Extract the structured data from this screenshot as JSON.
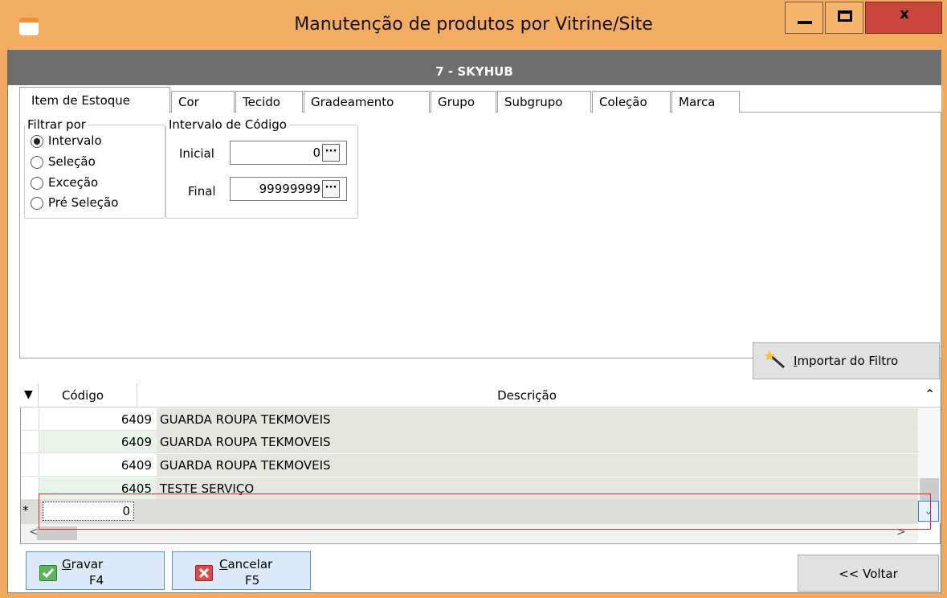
{
  "window": {
    "title": "Manutenção de produtos por Vitrine/Site",
    "minimize_icon": "minimize-icon",
    "maximize_icon": "maximize-icon",
    "close_label": "x"
  },
  "header": {
    "title": "7 - SKYHUB"
  },
  "tabs": [
    {
      "label": "Item de Estoque",
      "active": true
    },
    {
      "label": "Cor"
    },
    {
      "label": "Tecido"
    },
    {
      "label": "Gradeamento"
    },
    {
      "label": "Grupo"
    },
    {
      "label": "Subgrupo"
    },
    {
      "label": "Coleção"
    },
    {
      "label": "Marca"
    }
  ],
  "filter": {
    "legend": "Filtrar por",
    "options": [
      {
        "label": "Intervalo",
        "checked": true
      },
      {
        "label": "Seleção"
      },
      {
        "label": "Exceção"
      },
      {
        "label": "Pré Seleção"
      }
    ]
  },
  "interval": {
    "legend": "Intervalo de Código",
    "initial_label": "Inicial",
    "initial_value": "0",
    "final_label": "Final",
    "final_value": "99999999",
    "ellipsis": "···"
  },
  "import_button": {
    "label_rest": "mportar do Filtro",
    "label_underlined": "I",
    "icon": "magic-wand-icon"
  },
  "grid": {
    "columns": [
      "Código",
      "Descrição"
    ],
    "rows": [
      {
        "code": "6409",
        "description": "GUARDA ROUPA TEKMOVEIS"
      },
      {
        "code": "6409",
        "description": "GUARDA ROUPA TEKMOVEIS"
      },
      {
        "code": "6409",
        "description": "GUARDA ROUPA TEKMOVEIS"
      },
      {
        "code": "6405",
        "description": "TESTE SERVIÇO"
      }
    ],
    "new_row": {
      "marker": "*",
      "code": "0"
    }
  },
  "buttons": {
    "save": {
      "label_underlined": "G",
      "label_rest": "ravar",
      "shortcut": "F4",
      "icon": "check-icon"
    },
    "cancel": {
      "label_underlined": "C",
      "label_rest": "ancelar",
      "shortcut": "F5",
      "icon": "x-icon"
    },
    "back": {
      "label": "<< Voltar"
    }
  },
  "colors": {
    "title_bar": "#f3ad62",
    "header_bar": "#6e6e6e",
    "close_button": "#c9463d",
    "selection_outline": "#d23030"
  }
}
